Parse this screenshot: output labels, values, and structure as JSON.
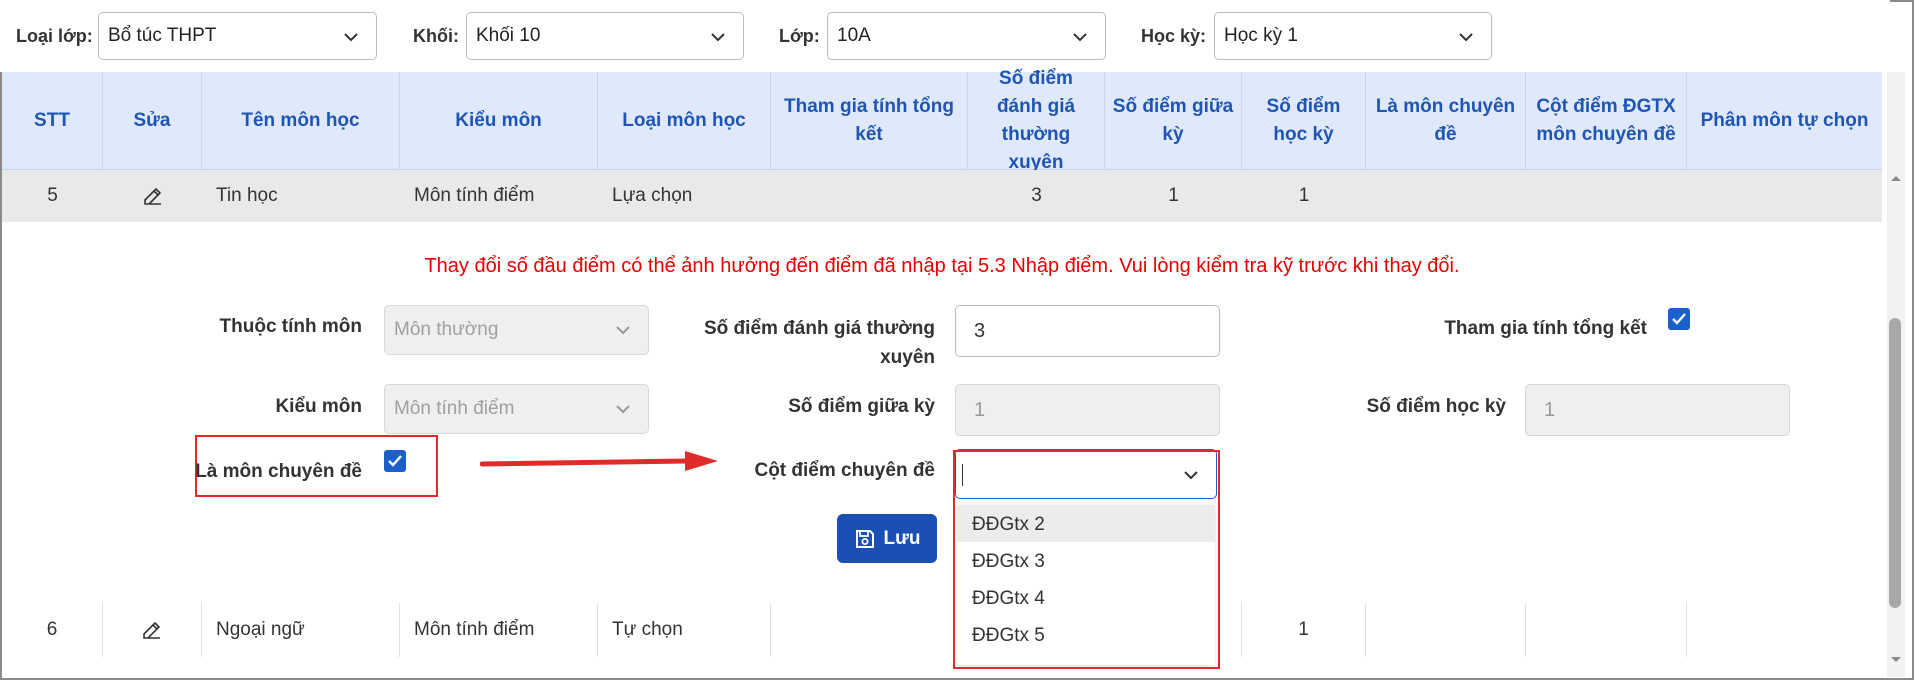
{
  "filters": [
    {
      "label": "Loại lớp:",
      "value": "Bổ túc THPT"
    },
    {
      "label": "Khối:",
      "value": "Khối 10"
    },
    {
      "label": "Lớp:",
      "value": "10A"
    },
    {
      "label": "Học kỳ:",
      "value": "Học kỳ 1"
    }
  ],
  "table": {
    "headers": [
      "STT",
      "Sửa",
      "Tên môn học",
      "Kiểu môn",
      "Loại môn học",
      "Tham gia tính tổng kết",
      "Số điểm đánh giá thường xuyên",
      "Số điểm giữa kỳ",
      "Số điểm học kỳ",
      "Là môn chuyên đề",
      "Cột điểm ĐGTX môn chuyên đề",
      "Phân môn tự chọn"
    ],
    "row5": {
      "stt": "5",
      "name": "Tin học",
      "kind": "Môn tính điểm",
      "type": "Lựa chọn",
      "tx": "3",
      "gk": "1",
      "hk": "1"
    },
    "row6": {
      "stt": "6",
      "name": "Ngoại ngữ",
      "kind": "Môn tính điểm",
      "type": "Tự chọn",
      "hk": "1"
    }
  },
  "panel": {
    "warning": "Thay đổi số đầu điểm có thể ảnh hưởng đến điểm đã nhập tại 5.3 Nhập điểm. Vui lòng kiểm tra kỹ trước khi thay đổi.",
    "thuoc_tinh_label": "Thuộc tính môn",
    "thuoc_tinh_value": "Môn thường",
    "kieu_mon_label": "Kiểu môn",
    "kieu_mon_value": "Môn tính điểm",
    "chuyen_de_label": "Là môn chuyên đề",
    "tx_label": "Số điểm đánh giá thường xuyên",
    "tx_value": "3",
    "gk_label": "Số điểm giữa kỳ",
    "gk_value": "1",
    "cot_diem_label": "Cột điểm chuyên đề",
    "tong_ket_label": "Tham gia tính tổng kết",
    "hk_label": "Số điểm học kỳ",
    "hk_value": "1",
    "save_label": "Lưu"
  },
  "dropdown": {
    "options": [
      "ĐĐGtx 2",
      "ĐĐGtx 3",
      "ĐĐGtx 4",
      "ĐĐGtx 5"
    ]
  },
  "colors": {
    "accent": "#1a4fb4",
    "header_bg": "#dfe9fb",
    "warning": "#e60000",
    "annotation": "#e02b2b"
  }
}
